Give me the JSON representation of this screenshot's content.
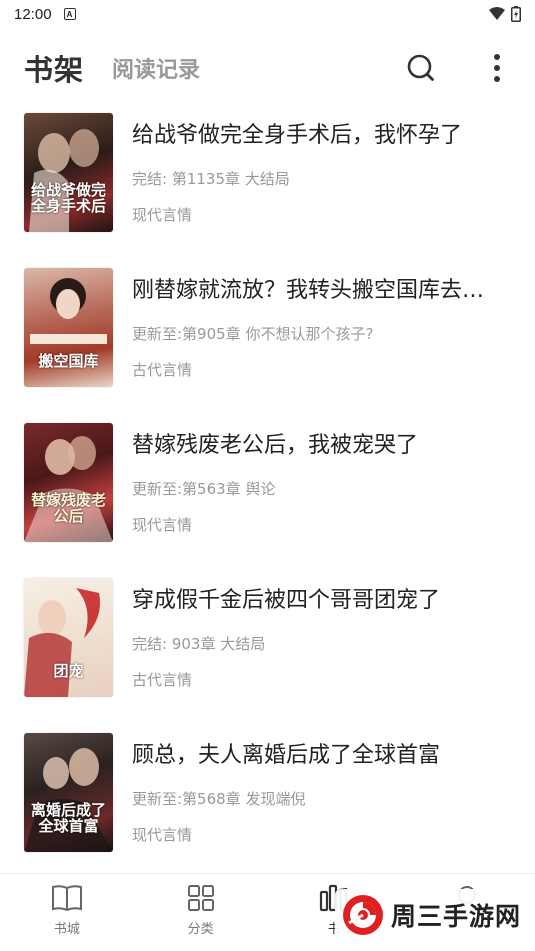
{
  "status_bar": {
    "time": "12:00",
    "notification_icon": "A"
  },
  "header": {
    "active_tab": "书架",
    "inactive_tab": "阅读记录"
  },
  "books": [
    {
      "title": "给战爷做完全身手术后，我怀孕了",
      "progress": "完结: 第1135章 大结局",
      "genre": "现代言情",
      "cover_text": "给战爷做完全身手术后"
    },
    {
      "title": "刚替嫁就流放？我转头搬空国库去…",
      "progress": "更新至:第905章 你不想认那个孩子?",
      "genre": "古代言情",
      "cover_text": "搬空国库"
    },
    {
      "title": "替嫁残废老公后，我被宠哭了",
      "progress": "更新至:第563章 舆论",
      "genre": "现代言情",
      "cover_text": "替嫁残废老公后"
    },
    {
      "title": "穿成假千金后被四个哥哥团宠了",
      "progress": "完结: 903章 大结局",
      "genre": "古代言情",
      "cover_text": "团宠"
    },
    {
      "title": "顾总，夫人离婚后成了全球首富",
      "progress": "更新至:第568章 发现端倪",
      "genre": "现代言情",
      "cover_text": "离婚后成了全球首富"
    }
  ],
  "bottom_nav": [
    {
      "label": "书城",
      "icon": "book-open-icon"
    },
    {
      "label": "分类",
      "icon": "grid-icon"
    },
    {
      "label": "书",
      "icon": "bookshelf-icon"
    },
    {
      "label": "",
      "icon": "search-icon"
    }
  ],
  "watermark": {
    "text": "周三手游网"
  },
  "colors": {
    "text_primary": "#222222",
    "text_secondary": "#999999",
    "watermark_red": "#e02020"
  }
}
